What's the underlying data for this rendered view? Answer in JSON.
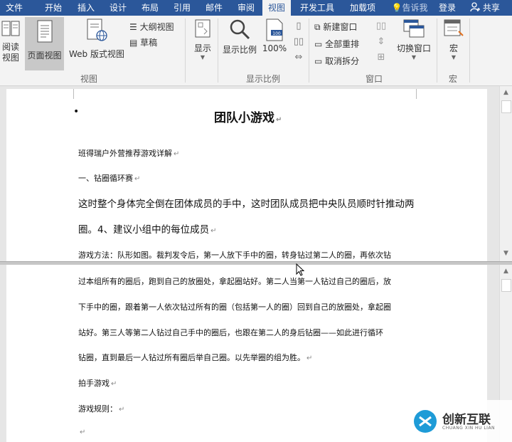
{
  "tabs": [
    {
      "label": "文件",
      "active": false
    },
    {
      "label": "开始",
      "active": false
    },
    {
      "label": "插入",
      "active": false
    },
    {
      "label": "设计",
      "active": false
    },
    {
      "label": "布局",
      "active": false
    },
    {
      "label": "引用",
      "active": false
    },
    {
      "label": "邮件",
      "active": false
    },
    {
      "label": "审阅",
      "active": false
    },
    {
      "label": "视图",
      "active": true
    },
    {
      "label": "开发工具",
      "active": false
    },
    {
      "label": "加载项",
      "active": false
    }
  ],
  "tellme": "告诉我",
  "signin": "登录",
  "share": "共享",
  "ribbon": {
    "view_group": {
      "read_mode": "阅读\n视图",
      "print_layout": "页面视图",
      "web_layout": "Web 版式视图",
      "outline": "大纲视图",
      "draft": "草稿",
      "group_label": "视图"
    },
    "show": "显示",
    "zoom_group": {
      "zoom": "显示比例",
      "percent": "100%",
      "group_label": "显示比例"
    },
    "window_group": {
      "new_window": "新建窗口",
      "arrange_all": "全部重排",
      "remove_split": "取消拆分",
      "switch_windows": "切换窗口",
      "group_label": "窗口"
    },
    "macros_group": {
      "macros": "宏",
      "group_label": "宏"
    }
  },
  "document_top": {
    "title": "团队小游戏",
    "line1": "班得瑞户外营推荐游戏详解",
    "line2": "一、钻圈循环赛",
    "line3": "这时整个身体完全倒在团体成员的手中，这时团队成员把中央队员顺时针推动两",
    "line4": "圈。4、建议小组中的每位成员",
    "line5": "游戏方法：队形如图。裁判发令后，第一人放下手中的圈，转身钻过第二人的圈，再依次钻"
  },
  "document_bottom": {
    "line1": "过本组所有的圈后，跑到自己的放圈处，拿起圈站好。第二人当第一人钻过自己的圈后，放",
    "line2": "下手中的圈，跟着第一人依次钻过所有的圈（包括第一人的圈）回到自己的放圈处，拿起圈",
    "line3": "站好。第三人等第二人钻过自己手中的圈后，也跟在第二人的身后钻圈——如此进行循环",
    "line4": "钻圈，直到最后一人钻过所有圈后举自己圈。以先举圈的组为胜。",
    "line5": "拍手游戏",
    "line6": "游戏规则：",
    "pilcrow": "↵"
  },
  "watermark": {
    "brand": "创新互联",
    "sub": "CHUANG XIN HU LIAN"
  },
  "colors": {
    "accent": "#2b579a",
    "ribbon_bg": "#f3f3f3",
    "workspace": "#e6e6e6"
  }
}
